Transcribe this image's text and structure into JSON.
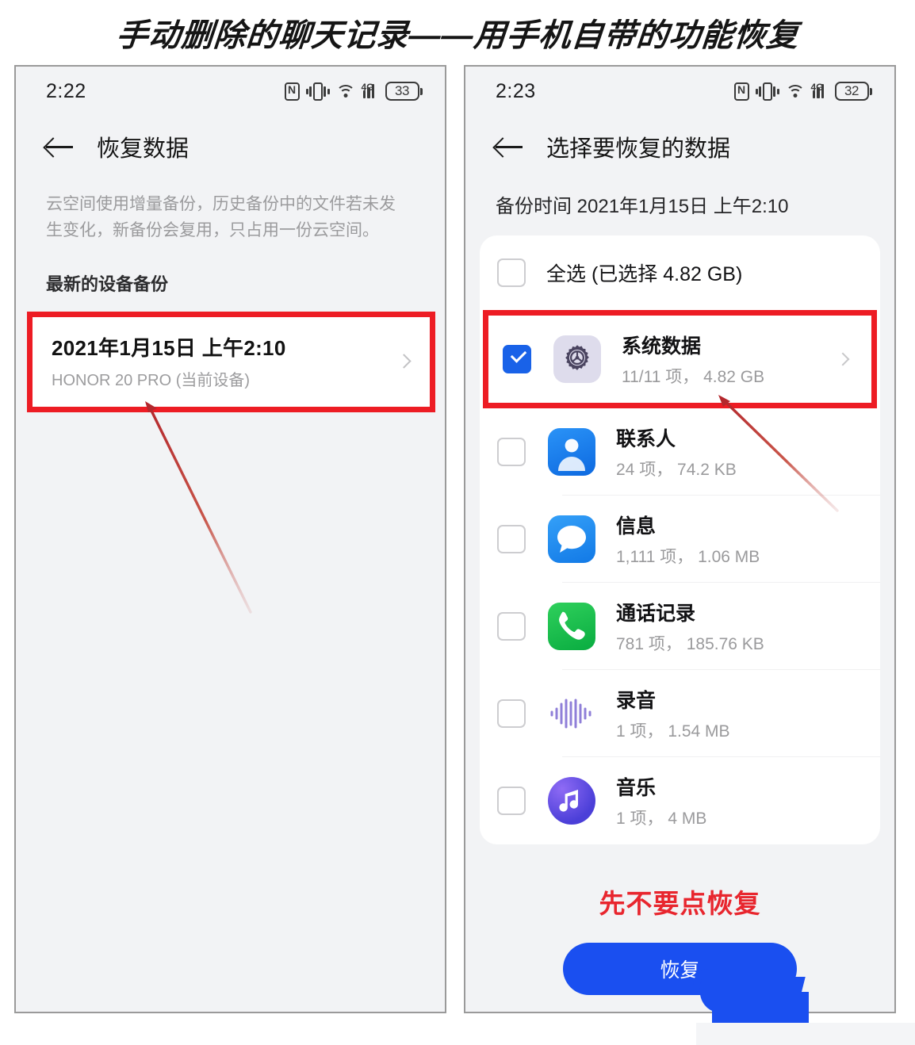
{
  "banner": {
    "title": "手动删除的聊天记录——用手机自带的功能恢复",
    "color": "#151515"
  },
  "theme": {
    "accent_blue": "#1a4ff0",
    "checkbox_blue": "#1962e8",
    "highlight_red": "#ed1c24",
    "warning_red": "#e8262e",
    "screen_bg": "#f2f3f5",
    "card_bg": "#ffffff"
  },
  "left_phone": {
    "status_bar": {
      "time": "2:22",
      "battery_percent": "33",
      "network": "4G",
      "icons": [
        "nfc-icon",
        "vibrate-icon",
        "wifi-icon",
        "signal-icon",
        "battery-icon"
      ]
    },
    "nav": {
      "back_icon": "back-arrow-icon",
      "title": "恢复数据"
    },
    "description": "云空间使用增量备份，历史备份中的文件若未发生变化，新备份会复用，只占用一份云空间。",
    "section_header": "最新的设备备份",
    "backup_item": {
      "title": "2021年1月15日 上午2:10",
      "subtitle": "HONOR 20 PRO (当前设备)",
      "chevron_icon": "chevron-right-icon",
      "highlighted": true
    }
  },
  "right_phone": {
    "status_bar": {
      "time": "2:23",
      "battery_percent": "32",
      "network": "4G",
      "icons": [
        "nfc-icon",
        "vibrate-icon",
        "wifi-icon",
        "signal-icon",
        "battery-icon"
      ]
    },
    "nav": {
      "back_icon": "back-arrow-icon",
      "title": "选择要恢复的数据"
    },
    "backup_time": "备份时间 2021年1月15日 上午2:10",
    "select_all": {
      "label": "全选 (已选择 4.82 GB)",
      "checked": false
    },
    "items": [
      {
        "name": "系统数据",
        "detail": "11/11 项，  4.82 GB",
        "checked": true,
        "icon": "gear-icon",
        "icon_bg": "#dedcec",
        "highlighted": true,
        "has_chevron": true
      },
      {
        "name": "联系人",
        "detail": "24 项，  74.2 KB",
        "checked": false,
        "icon": "contacts-person-icon",
        "icon_bg": "#1a84f0",
        "highlighted": false,
        "has_chevron": false
      },
      {
        "name": "信息",
        "detail": "1,111 项，  1.06 MB",
        "checked": false,
        "icon": "message-bubble-icon",
        "icon_bg": "#1f8df2",
        "highlighted": false,
        "has_chevron": false
      },
      {
        "name": "通话记录",
        "detail": "781 项，  185.76 KB",
        "checked": false,
        "icon": "phone-handset-icon",
        "icon_bg": "#16ba4a",
        "highlighted": false,
        "has_chevron": false
      },
      {
        "name": "录音",
        "detail": "1 项，  1.54 MB",
        "checked": false,
        "icon": "sound-recorder-waveform-icon",
        "icon_bg": "#ffffff",
        "highlighted": false,
        "has_chevron": false
      },
      {
        "name": "音乐",
        "detail": "1 项，  4 MB",
        "checked": false,
        "icon": "music-note-icon",
        "icon_bg": "#7a5ae8",
        "highlighted": false,
        "has_chevron": false
      }
    ],
    "warning_annotation": "先不要点恢复",
    "restore_button": "恢复"
  },
  "annotations": [
    {
      "name": "arrow-from-backup-item",
      "color": "#c0392b"
    },
    {
      "name": "arrow-from-system-data-row",
      "color": "#c0392b"
    }
  ]
}
